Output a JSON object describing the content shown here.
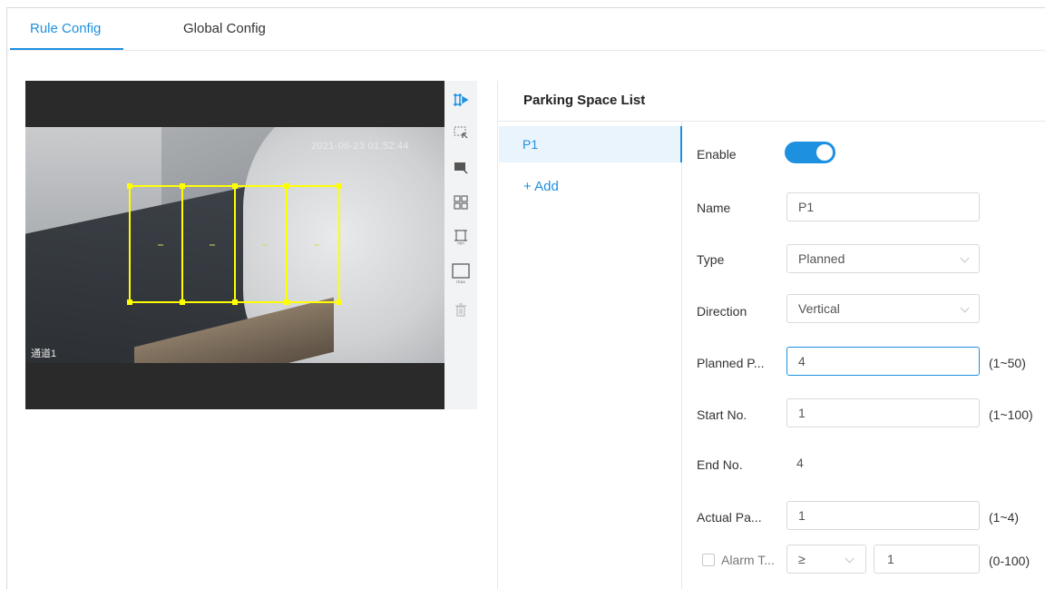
{
  "tabs": [
    {
      "label": "Rule Config",
      "active": true
    },
    {
      "label": "Global Config",
      "active": false
    }
  ],
  "video": {
    "timestamp": "2021-06-23 01:52:44",
    "channel": "通道1"
  },
  "toolbar": {
    "icons": [
      "draw-rule-icon",
      "select-area-icon",
      "clear-area-icon",
      "grid-icon",
      "min-size-icon",
      "max-size-icon",
      "delete-icon"
    ]
  },
  "panel": {
    "title": "Parking Space List",
    "items": [
      {
        "label": "P1"
      }
    ],
    "add_label": "+ Add"
  },
  "form": {
    "enable_label": "Enable",
    "enable_value": true,
    "name_label": "Name",
    "name_value": "P1",
    "type_label": "Type",
    "type_value": "Planned",
    "direction_label": "Direction",
    "direction_value": "Vertical",
    "planned_label": "Planned P...",
    "planned_value": "4",
    "planned_range": "(1~50)",
    "start_label": "Start No.",
    "start_value": "1",
    "start_range": "(1~100)",
    "end_label": "End No.",
    "end_value": "4",
    "actual_label": "Actual Pa...",
    "actual_value": "1",
    "actual_range": "(1~4)",
    "alarm_label": "Alarm T...",
    "alarm_checked": false,
    "alarm_operator": "≥",
    "alarm_value": "1",
    "alarm_range": "(0-100)"
  },
  "colors": {
    "accent": "#1e90e0",
    "overlay": "#ffff00"
  }
}
